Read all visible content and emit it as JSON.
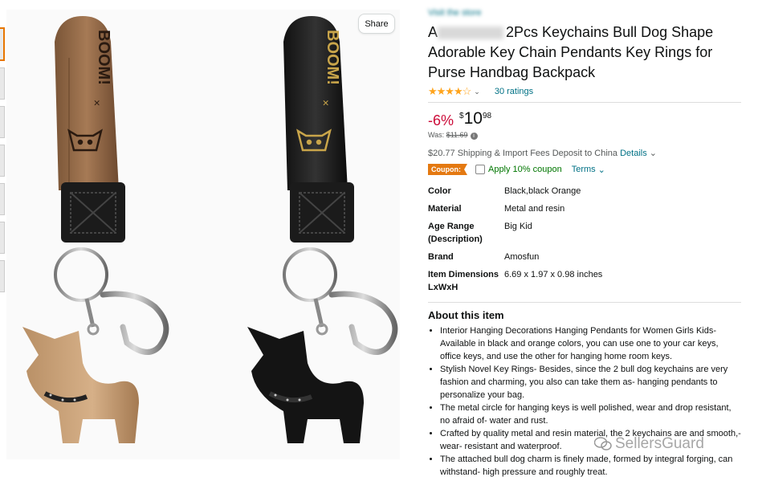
{
  "store_link": "Visit the store",
  "share_label": "Share",
  "title_visible": "2Pcs Keychains Bull Dog Shape Adorable Key Chain Pendants Key Rings for Purse Handbag Backpack",
  "title_prefix": "A",
  "rating": {
    "stars": "★★★★☆",
    "chevron": "⌄",
    "count_text": "30 ratings"
  },
  "price": {
    "discount": "-6%",
    "currency": "$",
    "whole": "10",
    "fraction": "98",
    "was_label": "Was:",
    "was_value": "$11.69"
  },
  "shipping": {
    "text": "$20.77 Shipping & Import Fees Deposit to China",
    "details_link": "Details",
    "chevron": "⌄"
  },
  "coupon": {
    "badge": "Coupon:",
    "apply_text": "Apply 10% coupon",
    "terms_link": "Terms",
    "chevron": "⌄"
  },
  "specs": [
    {
      "key": "Color",
      "value": "Black,black Orange"
    },
    {
      "key": "Material",
      "value": "Metal and resin"
    },
    {
      "key": "Age Range (Description)",
      "value": "Big Kid"
    },
    {
      "key": "Brand",
      "value": "Amosfun"
    },
    {
      "key": "Item Dimensions LxWxH",
      "value": "6.69 x 1.97 x 0.98 inches"
    }
  ],
  "about_heading": "About this item",
  "bullets": [
    "Interior Hanging Decorations Hanging Pendants for Women Girls Kids- Available in black and orange colors, you can use one to your car keys, office keys, and use the other for hanging home room keys.",
    "Stylish Novel Key Rings- Besides, since the 2 bull dog keychains are very fashion and charming, you also can take them as- hanging pendants to personalize your bag.",
    "The metal circle for hanging keys is well polished, wear and drop resistant, no afraid of- water and rust.",
    "Crafted by quality metal and resin material, the 2 keychains are and smooth,- wear- resistant and waterproof.",
    "The attached bull dog charm is finely made, formed by integral forging, can withstand- high pressure and roughly treat."
  ],
  "watermark": "SellersGuard",
  "strap_text": "BOOM!",
  "colors": {
    "accent": "#e77600",
    "link": "#007185",
    "discount": "#cc0c39",
    "coupon_badge": "#e47911",
    "coupon_text": "#007600",
    "star": "#ffa41c"
  }
}
